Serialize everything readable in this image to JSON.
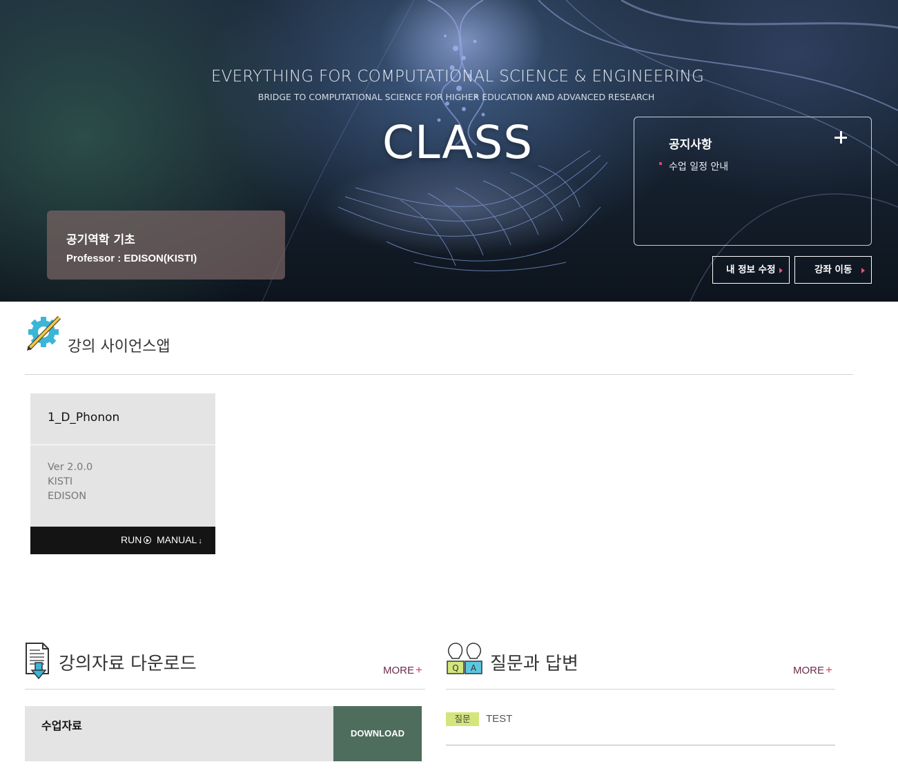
{
  "hero": {
    "headline": "EVERYTHING FOR COMPUTATIONAL SCIENCE & ENGINEERING",
    "subline": "BRIDGE TO COMPUTATIONAL SCIENCE FOR HIGHER EDUCATION AND ADVANCED RESEARCH",
    "class_label": "CLASS"
  },
  "course": {
    "title": "공기역학 기초",
    "professor": "Professor : EDISON(KISTI)"
  },
  "notice": {
    "title": "공지사항",
    "items": [
      "수업 일정 안내"
    ]
  },
  "hero_buttons": {
    "my_info": "내 정보 수정",
    "course_move": "강좌 이동"
  },
  "science_apps": {
    "title": "강의 사이언스앱",
    "apps": [
      {
        "name": "1_D_Phonon",
        "version": "Ver 2.0.0",
        "org": "KISTI",
        "author": "EDISON",
        "run_label": "RUN",
        "manual_label": "MANUAL"
      }
    ]
  },
  "downloads": {
    "title": "강의자료 다운로드",
    "more_label": "MORE",
    "items": [
      {
        "title": "수업자료",
        "button_label": "DOWNLOAD"
      }
    ]
  },
  "qna": {
    "title": "질문과 답변",
    "more_label": "MORE",
    "items": [
      {
        "badge": "질문",
        "text": "TEST"
      }
    ]
  },
  "colors": {
    "course_card_bg": "#7a6464",
    "download_button": "#4e6d5d",
    "more_text": "#6a2c4a",
    "more_plus": "#d23c5c",
    "qna_badge": "#d3e67d",
    "app_bar": "#141414"
  },
  "icons": {
    "science_apps": "gear-pencil-icon",
    "downloads": "document-download-icon",
    "qna": "qa-people-icon",
    "notice_more": "plus-icon",
    "run": "play-circle-icon",
    "manual": "download-arrow-icon"
  }
}
